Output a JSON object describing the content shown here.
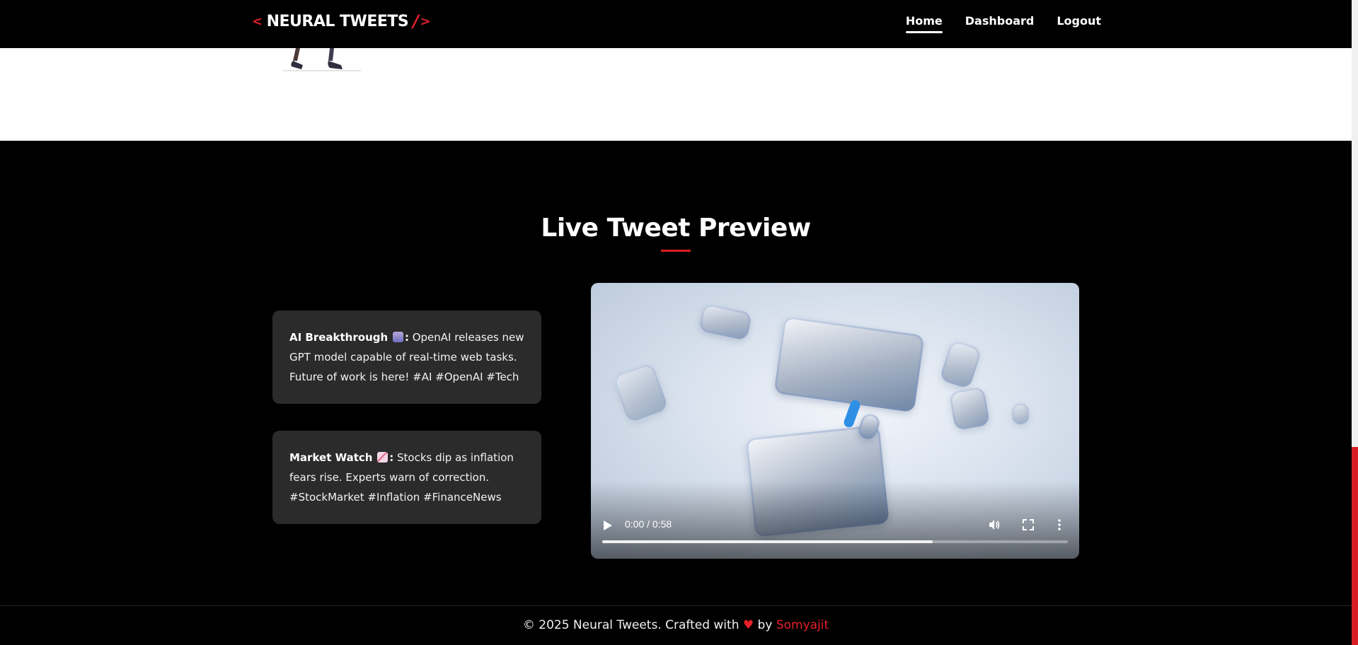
{
  "nav": {
    "brand_left": "<",
    "brand_name": "NEURAL TWEETS",
    "brand_slash": "/",
    "brand_right": ">",
    "links": [
      {
        "label": "Home",
        "active": true
      },
      {
        "label": "Dashboard",
        "active": false
      },
      {
        "label": "Logout",
        "active": false
      }
    ]
  },
  "section": {
    "title": "Live Tweet Preview"
  },
  "tweets": [
    {
      "title": "AI Breakthrough",
      "emoji": "robot-icon",
      "sep": ":",
      "text": " OpenAI releases new GPT model capable of real-time web tasks. Future of work is here! #AI #OpenAI #Tech"
    },
    {
      "title": "Market Watch",
      "emoji": "chart-decreasing-icon",
      "sep": ":",
      "text": " Stocks dip as inflation fears rise. Experts warn of correction. #StockMarket #Inflation #FinanceNews"
    }
  ],
  "video": {
    "time": "0:00 / 0:58",
    "progress_fraction": 0.71
  },
  "footer": {
    "prefix": "© 2025 Neural Tweets. Crafted with",
    "heart": "♥",
    "by": "by",
    "author": "Somyajit"
  },
  "colors": {
    "accent": "#e5202a",
    "background": "#000000",
    "card": "#2b2b2b"
  }
}
